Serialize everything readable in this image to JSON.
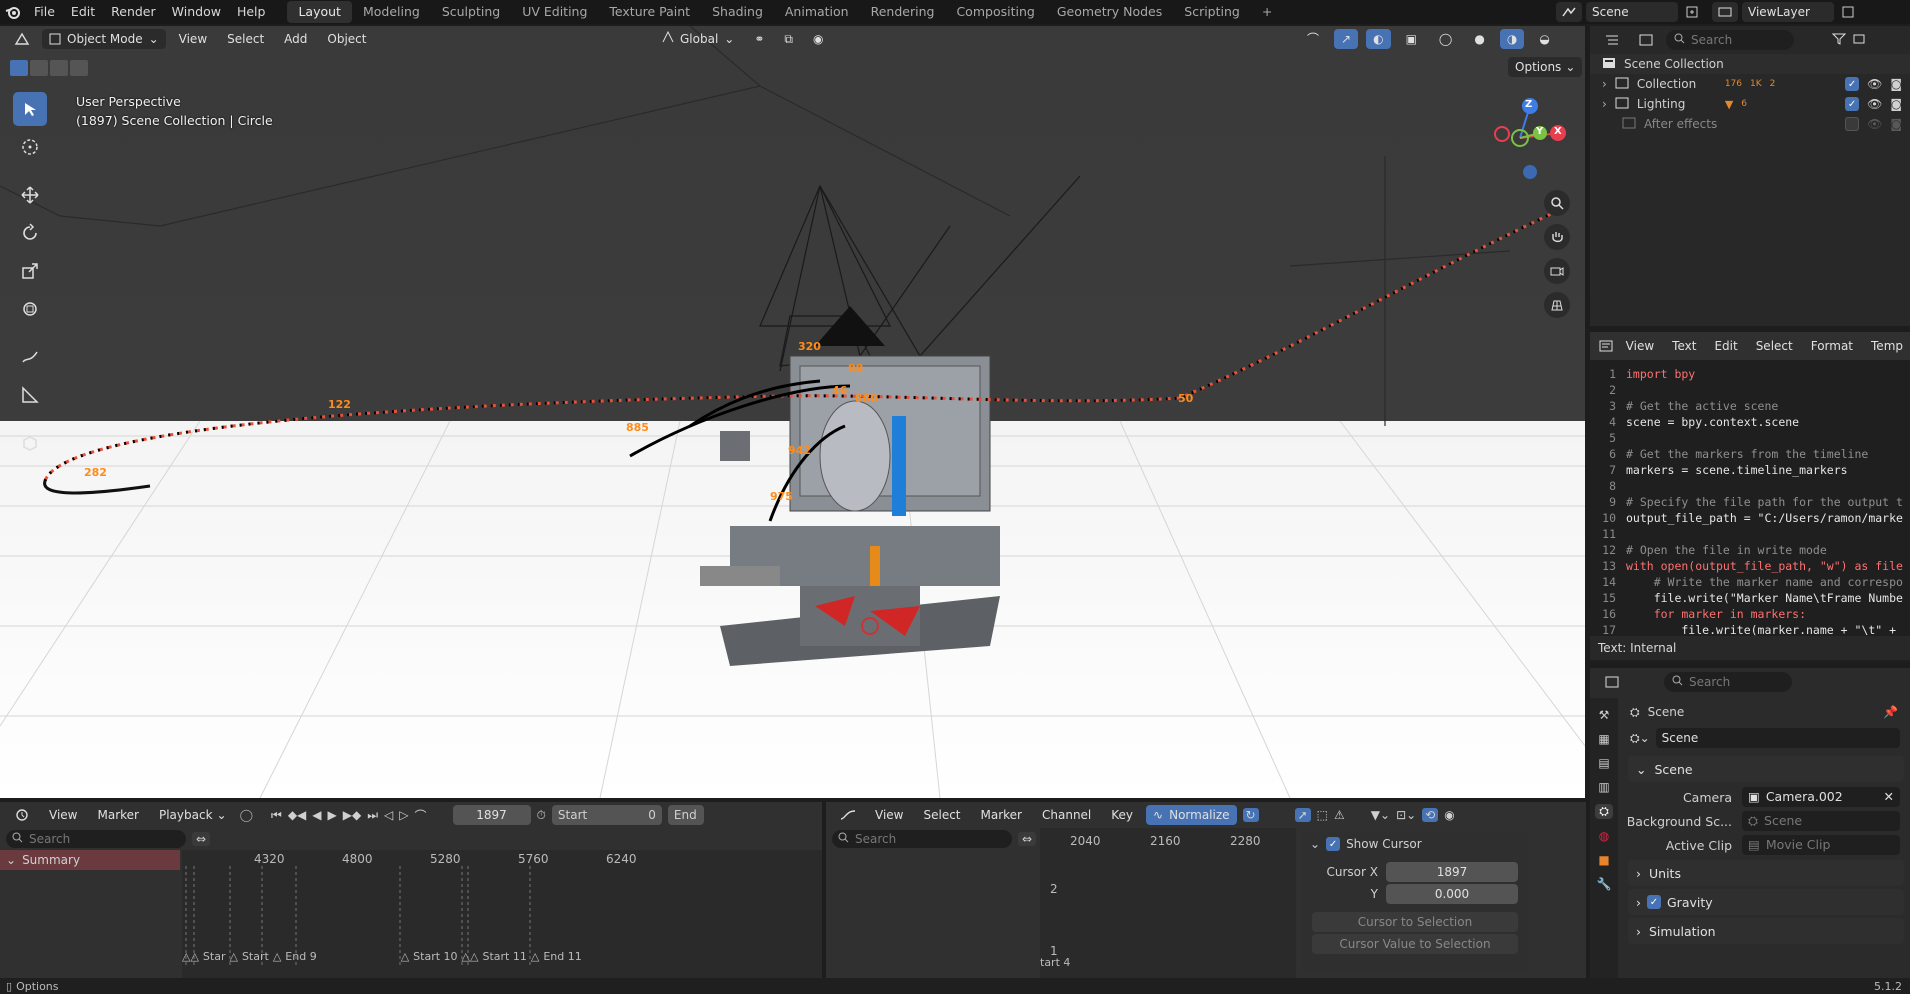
{
  "menubar": {
    "items": [
      "File",
      "Edit",
      "Render",
      "Window",
      "Help"
    ],
    "workspaces": [
      "Layout",
      "Modeling",
      "Sculpting",
      "UV Editing",
      "Texture Paint",
      "Shading",
      "Animation",
      "Rendering",
      "Compositing",
      "Geometry Nodes",
      "Scripting"
    ],
    "active_workspace": "Layout",
    "add_tab": "+",
    "scene": "Scene",
    "view_layer": "ViewLayer"
  },
  "viewport": {
    "mode": "Object Mode",
    "menus": [
      "View",
      "Select",
      "Add",
      "Object"
    ],
    "orientation": "Global",
    "options": "Options",
    "perspective": "User Perspective",
    "context": "(1897) Scene Collection | Circle",
    "gizmo": {
      "z": "Z",
      "y": "Y",
      "x": "X"
    },
    "markers": [
      "320",
      "122",
      "282",
      "885",
      "50",
      "942",
      "975",
      "880",
      "46",
      "88"
    ]
  },
  "outliner": {
    "search_placeholder": "Search",
    "root": "Scene Collection",
    "items": [
      {
        "label": "Collection",
        "counts": [
          "176",
          "1K",
          "2"
        ]
      },
      {
        "label": "Lighting",
        "counts": [
          "",
          "6"
        ]
      },
      {
        "label": "After effects",
        "counts": []
      }
    ]
  },
  "text_editor": {
    "menus": [
      "View",
      "Text",
      "Edit",
      "Select",
      "Format",
      "Temp"
    ],
    "lines": [
      "import bpy",
      "",
      "# Get the active scene",
      "scene = bpy.context.scene",
      "",
      "# Get the markers from the timeline",
      "markers = scene.timeline_markers",
      "",
      "# Specify the file path for the output t",
      "output_file_path = \"C:/Users/ramon/marke",
      "",
      "# Open the file in write mode",
      "with open(output_file_path, \"w\") as file",
      "    # Write the marker name and correspo",
      "    file.write(\"Marker Name\\tFrame Numbe",
      "    for marker in markers:",
      "        file.write(marker.name + \"\\t\" +"
    ],
    "status": "Text: Internal"
  },
  "properties": {
    "search_placeholder": "Search",
    "context": "Scene",
    "datablock": "Scene",
    "section": "Scene",
    "camera_label": "Camera",
    "camera_value": "Camera.002",
    "bg_label": "Background Sc...",
    "bg_value": "Scene",
    "clip_label": "Active Clip",
    "clip_value": "Movie Clip",
    "sub_units": "Units",
    "sub_gravity": "Gravity",
    "sub_simulation": "Simulation"
  },
  "dopesheet": {
    "menus": [
      "View",
      "Marker",
      "Playback"
    ],
    "frame": "1897",
    "start_label": "Start",
    "start_value": "0",
    "end_label": "End",
    "search_placeholder": "Search",
    "summary": "Summary",
    "ruler": [
      "4320",
      "4800",
      "5280",
      "5760",
      "6240"
    ],
    "marker_labels": [
      "Star",
      "Start",
      "End 9",
      "Start 10",
      "Start 11",
      "End 11"
    ]
  },
  "graph_editor": {
    "menus": [
      "View",
      "Select",
      "Marker",
      "Channel",
      "Key"
    ],
    "normalize": "Normalize",
    "search_placeholder": "Search",
    "ruler": [
      "2040",
      "2160",
      "2280"
    ],
    "y_labels": [
      "2",
      "1"
    ],
    "marker_label": "tart 4",
    "show_cursor": "Show Cursor",
    "cursor_x_label": "Cursor X",
    "cursor_x_value": "1897",
    "y_label": "Y",
    "y_value": "0.000",
    "btn_cursor_to_sel": "Cursor to Selection",
    "btn_cursor_val_to_sel": "Cursor Value to Selection"
  },
  "statusbar": {
    "options": "Options",
    "version": "5.1.2"
  },
  "colors": {
    "accent": "#4772b3",
    "marker_orange": "#ff8c1a",
    "path_red": "#e8503a"
  }
}
